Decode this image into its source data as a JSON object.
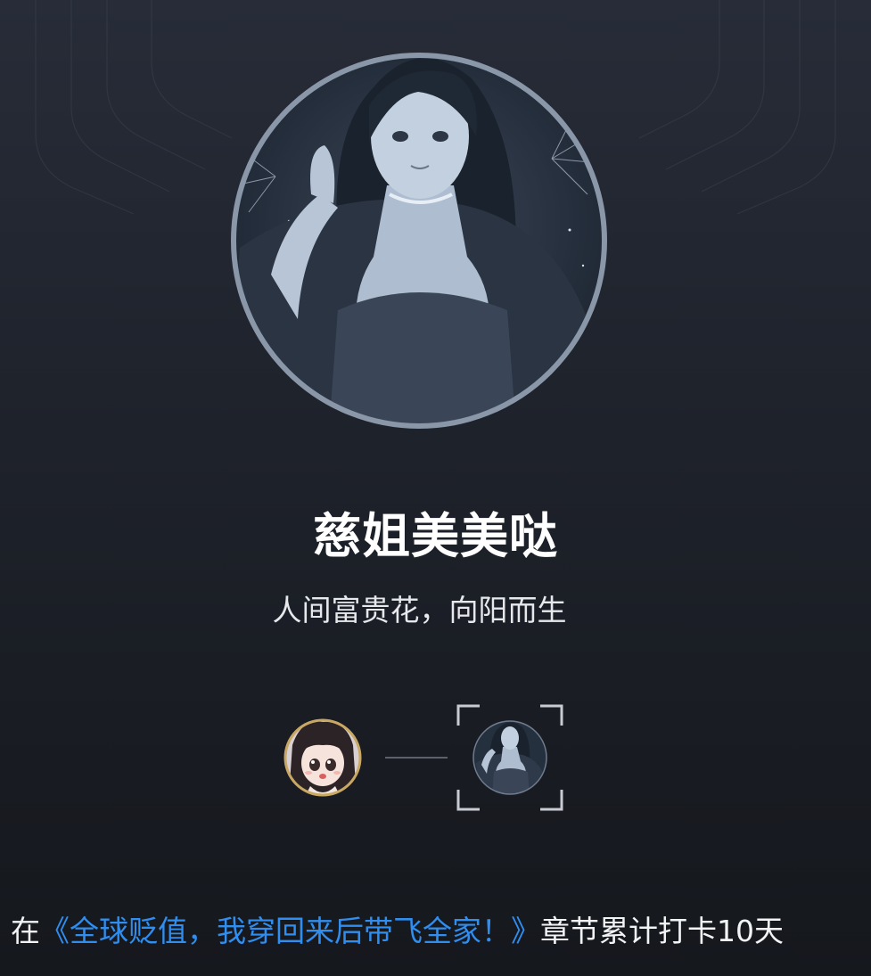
{
  "profile": {
    "title": "慈姐美美哒",
    "motto": "人间富贵花，向阳而生"
  },
  "achievement": {
    "prefix": "在",
    "book_title": "《全球贬值，我穿回来后带飞全家！》",
    "suffix": "章节累计打卡10天"
  },
  "colors": {
    "background_top": "#272c38",
    "background_bottom": "#15181d",
    "link": "#2f8ef0",
    "text_primary": "#ffffff",
    "avatar_ring": "#8a97a8",
    "small_avatar_ring": "#c9a864"
  },
  "icons": {
    "main_avatar": "character-portrait-avatar",
    "current_avatar": "chibi-character-avatar",
    "next_avatar": "character-portrait-avatar",
    "frame": "scan-frame-corners"
  }
}
